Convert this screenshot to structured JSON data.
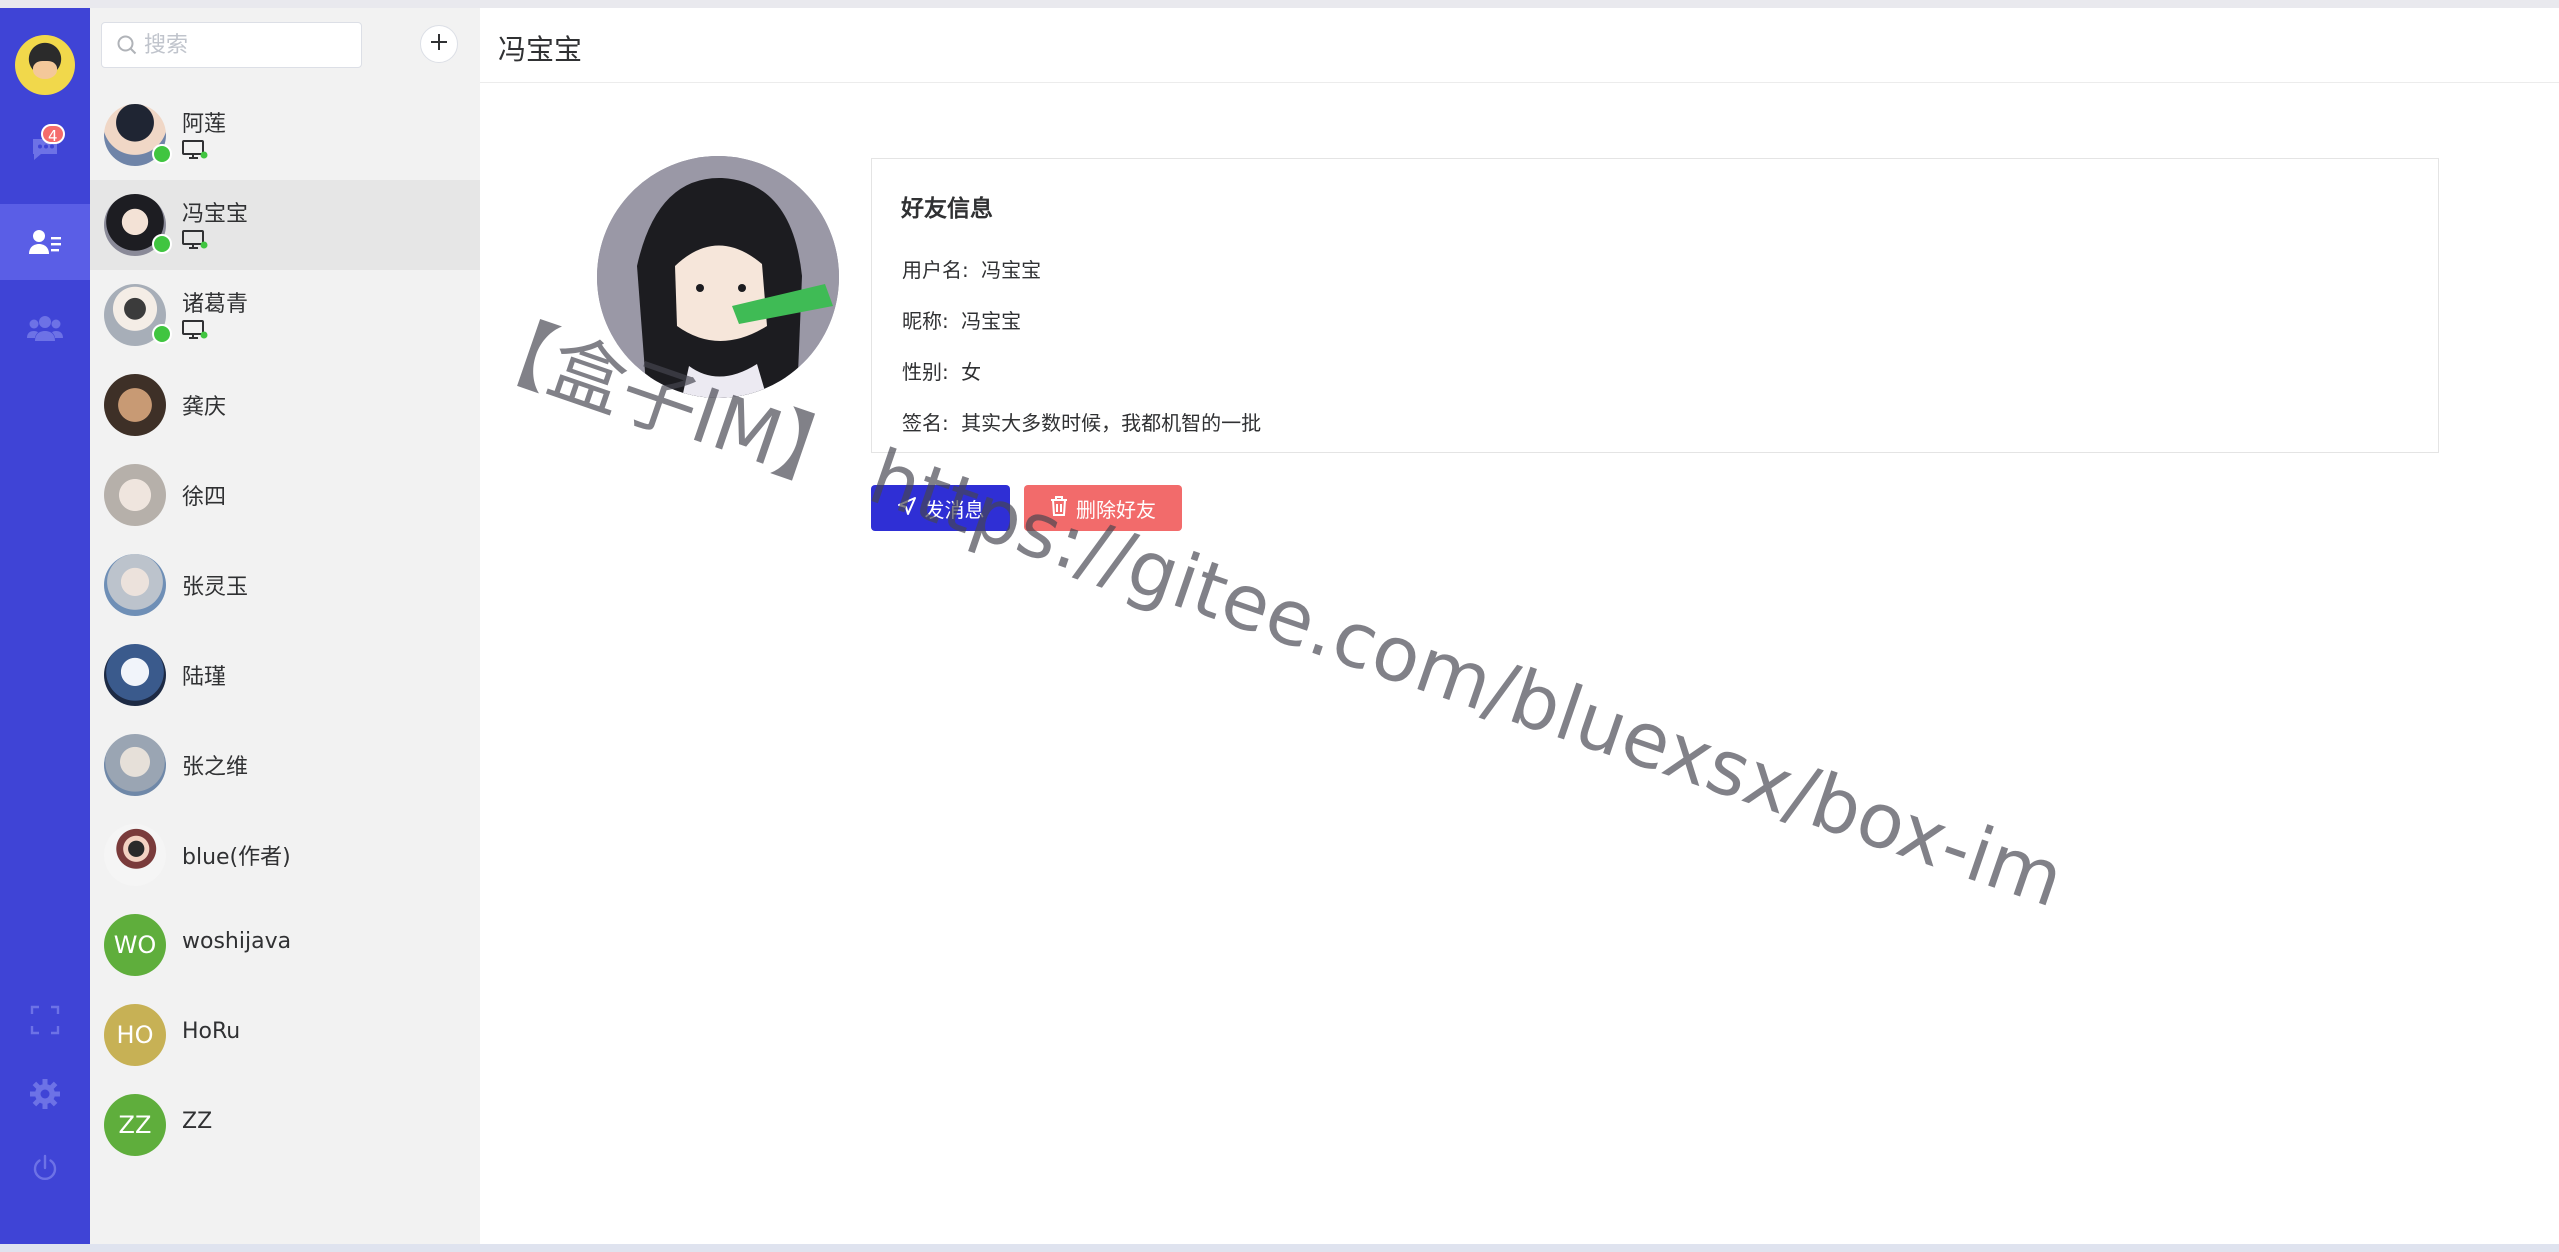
{
  "nav": {
    "chat_badge": "4",
    "items": [
      "chat-icon",
      "contacts-icon",
      "group-icon",
      "fullscreen-icon",
      "settings-icon",
      "power-icon"
    ]
  },
  "search": {
    "placeholder": "搜索"
  },
  "contacts": [
    {
      "name": "阿莲",
      "online": true,
      "avatar_color": "#5a6f8f"
    },
    {
      "name": "冯宝宝",
      "online": true,
      "avatar_color": "#7a7a88"
    },
    {
      "name": "诸葛青",
      "online": true,
      "avatar_color": "#9aa0aa"
    },
    {
      "name": "龚庆",
      "online": false,
      "avatar_color": "#6d5a47"
    },
    {
      "name": "徐四",
      "online": false,
      "avatar_color": "#b8b3ad"
    },
    {
      "name": "张灵玉",
      "online": false,
      "avatar_color": "#8ea1b8"
    },
    {
      "name": "陆瑾",
      "online": false,
      "avatar_color": "#4f6f9a"
    },
    {
      "name": "张之维",
      "online": false,
      "avatar_color": "#9aa5b3"
    },
    {
      "name": "blue(作者)",
      "online": false,
      "avatar_color": "#e9e9e9"
    },
    {
      "name": "woshijava",
      "online": false,
      "initials": "WO",
      "avatar_color": "#5fae3c"
    },
    {
      "name": "HoRu",
      "online": false,
      "initials": "HO",
      "avatar_color": "#c7b155"
    },
    {
      "name": "ZZ",
      "online": false,
      "initials": "ZZ",
      "avatar_color": "#5fae3c"
    }
  ],
  "main": {
    "title": "冯宝宝",
    "card_title": "好友信息",
    "username_label": "用户名:",
    "username": "冯宝宝",
    "nickname_label": "昵称:",
    "nickname": "冯宝宝",
    "gender_label": "性别:",
    "gender": "女",
    "signature_label": "签名:",
    "signature": "其实大多数时候，我都机智的一批",
    "send_label": "发消息",
    "delete_label": "删除好友"
  },
  "watermark": "【盒子IM】 https://gitee.com/bluexsx/box-im"
}
